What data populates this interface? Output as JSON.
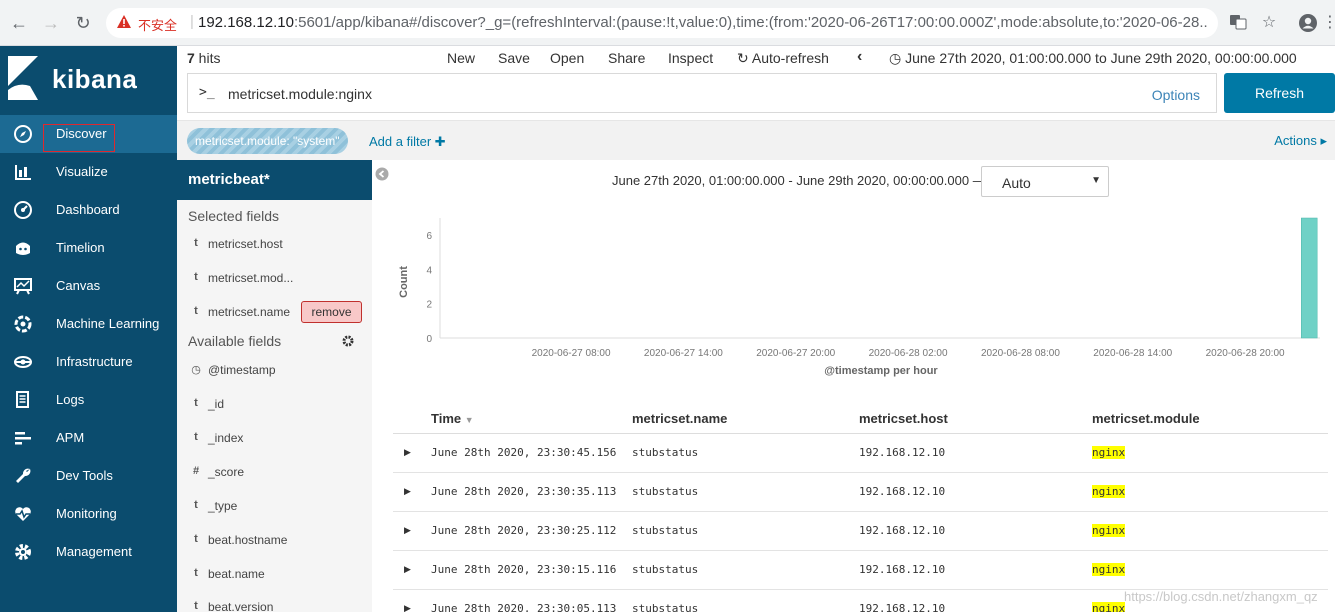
{
  "browser": {
    "insecure_label": "不安全",
    "url_host": "192.168.12.10",
    "url_rest": ":5601/app/kibana#/discover?_g=(refreshInterval:(pause:!t,value:0),time:(from:'2020-06-26T17:00:00.000Z',mode:absolute,to:'2020-06-28..."
  },
  "sidebar": {
    "logo_text": "kibana",
    "items": [
      {
        "label": "Discover",
        "icon": "compass-icon"
      },
      {
        "label": "Visualize",
        "icon": "bar-chart-icon"
      },
      {
        "label": "Dashboard",
        "icon": "gauge-icon"
      },
      {
        "label": "Timelion",
        "icon": "timelion-icon"
      },
      {
        "label": "Canvas",
        "icon": "canvas-icon"
      },
      {
        "label": "Machine Learning",
        "icon": "ml-icon"
      },
      {
        "label": "Infrastructure",
        "icon": "infrastructure-icon"
      },
      {
        "label": "Logs",
        "icon": "logs-icon"
      },
      {
        "label": "APM",
        "icon": "apm-icon"
      },
      {
        "label": "Dev Tools",
        "icon": "wrench-icon"
      },
      {
        "label": "Monitoring",
        "icon": "heartbeat-icon"
      },
      {
        "label": "Management",
        "icon": "gear-icon"
      }
    ]
  },
  "toolbar": {
    "hits_count": "7",
    "hits_label": " hits",
    "new": "New",
    "save": "Save",
    "open": "Open",
    "share": "Share",
    "inspect": "Inspect",
    "auto_refresh": "Auto-refresh",
    "time_range": "June 27th 2020, 01:00:00.000 to June 29th 2020, 00:00:00.000"
  },
  "query": {
    "prompt": ">_",
    "text": "metricset.module:nginx",
    "options": "Options",
    "refresh": "Refresh"
  },
  "filters": {
    "pill": "metricset.module: \"system\"",
    "add_filter": "Add a filter",
    "actions": "Actions"
  },
  "fields": {
    "index_pattern": "metricbeat*",
    "selected_title": "Selected fields",
    "available_title": "Available fields",
    "remove_label": "remove",
    "selected": [
      {
        "type": "t",
        "name": "metricset.host"
      },
      {
        "type": "t",
        "name": "metricset.mod..."
      },
      {
        "type": "t",
        "name": "metricset.name"
      }
    ],
    "available": [
      {
        "type": "clock",
        "name": "@timestamp"
      },
      {
        "type": "t",
        "name": "_id"
      },
      {
        "type": "t",
        "name": "_index"
      },
      {
        "type": "#",
        "name": "_score"
      },
      {
        "type": "t",
        "name": "_type"
      },
      {
        "type": "t",
        "name": "beat.hostname"
      },
      {
        "type": "t",
        "name": "beat.name"
      },
      {
        "type": "t",
        "name": "beat.version"
      }
    ]
  },
  "histogram": {
    "range_label": "June 27th 2020, 01:00:00.000 - June 29th 2020, 00:00:00.000 —",
    "interval": "Auto"
  },
  "chart_data": {
    "type": "bar",
    "xlabel": "@timestamp per hour",
    "ylabel": "Count",
    "ylim": [
      0,
      7
    ],
    "y_ticks": [
      0,
      2,
      4,
      6
    ],
    "x_tick_labels": [
      "2020-06-27 08:00",
      "2020-06-27 14:00",
      "2020-06-27 20:00",
      "2020-06-28 02:00",
      "2020-06-28 08:00",
      "2020-06-28 14:00",
      "2020-06-28 20:00"
    ],
    "x_range_hours": [
      0,
      47
    ],
    "bars": [
      {
        "hour": 46,
        "value": 7
      }
    ],
    "bar_color": "#6fd1c6",
    "grid": false
  },
  "table": {
    "columns": [
      "Time",
      "metricset.name",
      "metricset.host",
      "metricset.module"
    ],
    "rows": [
      {
        "time": "June 28th 2020, 23:30:45.156",
        "name": "stubstatus",
        "host": "192.168.12.10",
        "module": "nginx"
      },
      {
        "time": "June 28th 2020, 23:30:35.113",
        "name": "stubstatus",
        "host": "192.168.12.10",
        "module": "nginx"
      },
      {
        "time": "June 28th 2020, 23:30:25.112",
        "name": "stubstatus",
        "host": "192.168.12.10",
        "module": "nginx"
      },
      {
        "time": "June 28th 2020, 23:30:15.116",
        "name": "stubstatus",
        "host": "192.168.12.10",
        "module": "nginx"
      },
      {
        "time": "June 28th 2020, 23:30:05.113",
        "name": "stubstatus",
        "host": "192.168.12.10",
        "module": "nginx"
      }
    ]
  },
  "watermark": "https://blog.csdn.net/zhangxm_qz",
  "colors": {
    "sidebar_bg": "#0b4c6e",
    "active_nav": "#1c6a93",
    "primary": "#0079a5",
    "highlight": "#ffff00"
  }
}
